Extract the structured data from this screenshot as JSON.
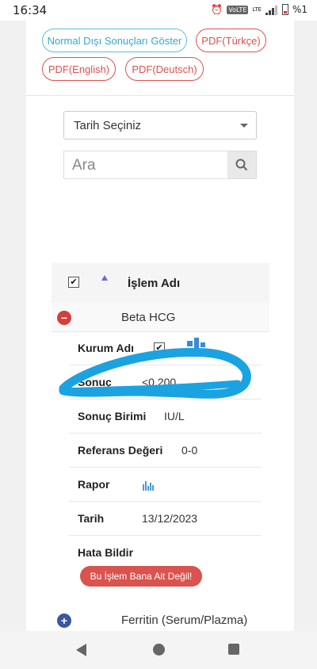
{
  "status_bar": {
    "time": "16:34",
    "network": "VoLTE",
    "lte": "LTE",
    "battery": "%1"
  },
  "buttons": {
    "show_abnormal": "Normal Dışı Sonuçları Göster",
    "pdf_tr": "PDF(Türkçe)",
    "pdf_en": "PDF(English)",
    "pdf_de": "PDF(Deutsch)"
  },
  "date_select": {
    "value": "Tarih Seçiniz"
  },
  "search": {
    "placeholder": "Ara"
  },
  "table": {
    "header": {
      "column": "İşlem Adı",
      "checked": true
    },
    "rows": [
      {
        "name": "Beta HCG",
        "expanded": true,
        "details": {
          "kurum_label": "Kurum Adı",
          "sonuc_label": "Sonuç",
          "sonuc_value": "<0,200",
          "birim_label": "Sonuç Birimi",
          "birim_value": "IU/L",
          "referans_label": "Referans Değeri",
          "referans_value": "0-0",
          "rapor_label": "Rapor",
          "tarih_label": "Tarih",
          "tarih_value": "13/12/2023",
          "hata_label": "Hata Bildir",
          "report_button": "Bu İşlem Bana Ait Değil!"
        }
      },
      {
        "name": "Ferritin (Serum/Plazma)",
        "expanded": false
      }
    ]
  },
  "colors": {
    "danger": "#d9534f",
    "info": "#5bc0de",
    "primary_toggle": "#3a57a0",
    "scribble": "#1aa3e0"
  }
}
